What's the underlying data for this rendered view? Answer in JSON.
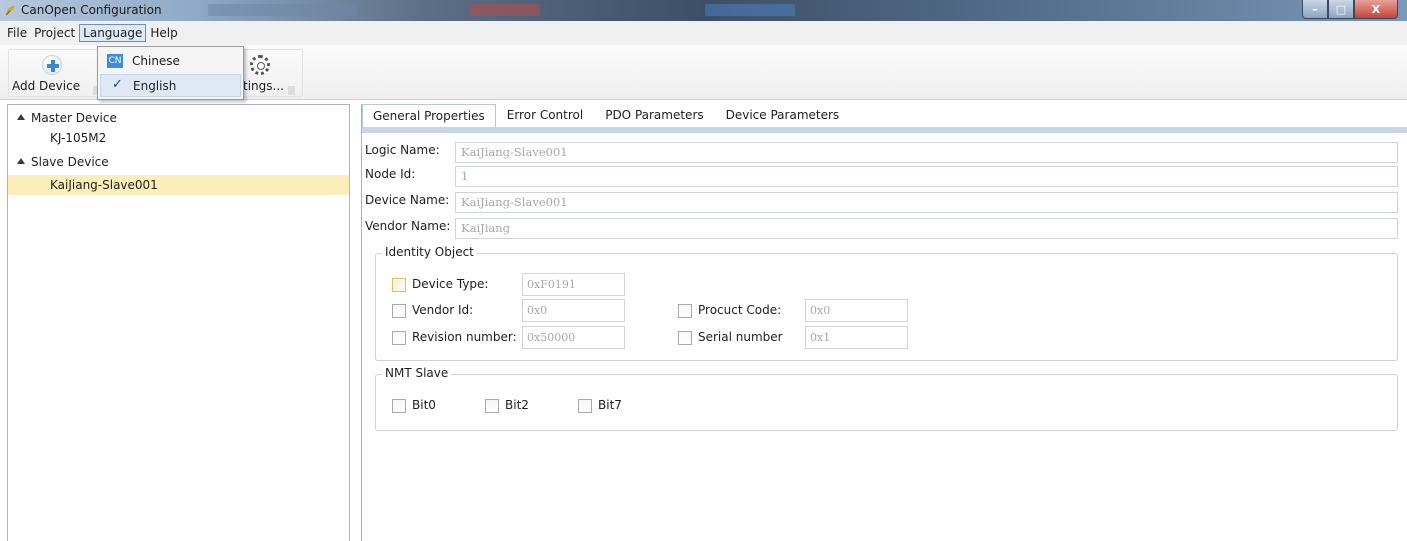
{
  "window": {
    "title": "CanOpen Configuration"
  },
  "menubar": {
    "items": [
      "File",
      "Project",
      "Language",
      "Help"
    ]
  },
  "toolbar": {
    "add_device_label": "Add Device",
    "settings_label": "tings..."
  },
  "language_menu": {
    "items": [
      {
        "icon_text": "CN",
        "label": "Chinese"
      },
      {
        "check": "✓",
        "label": "English"
      }
    ]
  },
  "tree": {
    "nodes": [
      "Master Device",
      "KJ-105M2",
      "Slave Device",
      "KaiJiang-Slave001"
    ]
  },
  "tabs": [
    "General Properties",
    "Error Control",
    "PDO Parameters",
    "Device Parameters"
  ],
  "general": {
    "logic_name_label": "Logic Name:",
    "logic_name_value": "KaiJiang-Slave001",
    "node_id_label": "Node Id:",
    "node_id_value": "1",
    "device_name_label": "Device Name:",
    "device_name_value": "KaiJiang-Slave001",
    "vendor_name_label": "Vendor Name:",
    "vendor_name_value": "KaiJiang"
  },
  "identity": {
    "title": "Identity Object",
    "device_type_label": "Device Type:",
    "device_type_value": "0xF0191",
    "vendor_id_label": "Vendor Id:",
    "vendor_id_value": "0x0",
    "product_code_label": "Procuct Code:",
    "product_code_value": "0x0",
    "revision_label": "Revision number:",
    "revision_value": "0x50000",
    "serial_label": "Serial number",
    "serial_value": "0x1"
  },
  "nmt": {
    "title": "NMT Slave",
    "bits": [
      "Bit0",
      "Bit2",
      "Bit7"
    ]
  }
}
